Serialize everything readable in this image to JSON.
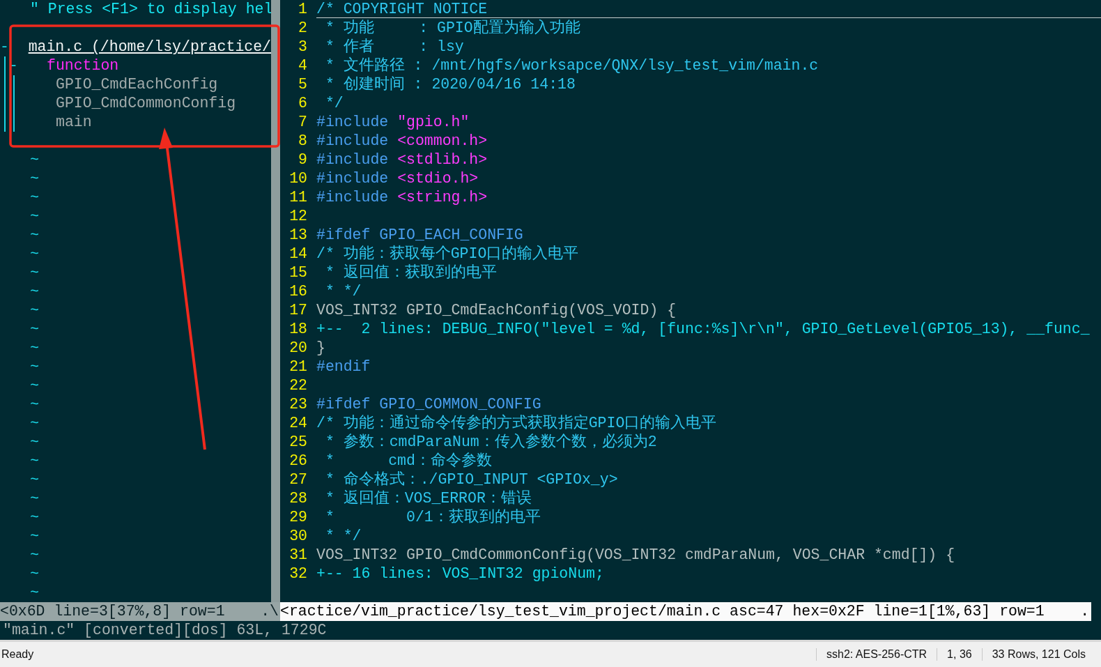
{
  "tag_list": {
    "help": "\" Press <F1> to display hel",
    "tree": {
      "marker": "-",
      "label": "main.c (/home/lsy/practice/",
      "children": [
        {
          "marker": "-",
          "label": "function",
          "children": [
            {
              "label": "GPIO_CmdEachConfig"
            },
            {
              "label": "GPIO_CmdCommonConfig"
            },
            {
              "label": "main"
            }
          ]
        }
      ]
    },
    "filler_rows": [
      "~",
      "~",
      "~",
      "~",
      "~",
      "~",
      "~",
      "~",
      "~",
      "~",
      "~",
      "~",
      "~",
      "~",
      "~",
      "~",
      "~",
      "~",
      "~",
      "~",
      "~",
      "~",
      "~",
      "~"
    ],
    "status_line": "<0x6D line=3[37%,8] row=1    .\\"
  },
  "editor": {
    "lines": [
      {
        "number": "1",
        "cursor_line": true,
        "segments": [
          {
            "kind": "comment",
            "text": "/* COPYRIGHT NOTICE"
          }
        ]
      },
      {
        "number": "2",
        "segments": [
          {
            "kind": "comment",
            "text": " * 功能     : GPIO配置为输入功能"
          }
        ]
      },
      {
        "number": "3",
        "segments": [
          {
            "kind": "comment",
            "text": " * 作者     : lsy"
          }
        ]
      },
      {
        "number": "4",
        "segments": [
          {
            "kind": "comment",
            "text": " * 文件路径 : /mnt/hgfs/worksapce/QNX/lsy_test_vim/main.c"
          }
        ]
      },
      {
        "number": "5",
        "segments": [
          {
            "kind": "comment",
            "text": " * 创建时间 : 2020/04/16 14:18"
          }
        ]
      },
      {
        "number": "6",
        "segments": [
          {
            "kind": "comment",
            "text": " */"
          }
        ]
      },
      {
        "number": "7",
        "segments": [
          {
            "kind": "preproc",
            "text": "#include "
          },
          {
            "kind": "string",
            "text": "\"gpio.h\""
          }
        ]
      },
      {
        "number": "8",
        "segments": [
          {
            "kind": "preproc",
            "text": "#include "
          },
          {
            "kind": "string",
            "text": "<common.h>"
          }
        ]
      },
      {
        "number": "9",
        "segments": [
          {
            "kind": "preproc",
            "text": "#include "
          },
          {
            "kind": "string",
            "text": "<stdlib.h>"
          }
        ]
      },
      {
        "number": "10",
        "segments": [
          {
            "kind": "preproc",
            "text": "#include "
          },
          {
            "kind": "string",
            "text": "<stdio.h>"
          }
        ]
      },
      {
        "number": "11",
        "segments": [
          {
            "kind": "preproc",
            "text": "#include "
          },
          {
            "kind": "string",
            "text": "<string.h>"
          }
        ]
      },
      {
        "number": "12"
      },
      {
        "number": "13",
        "segments": [
          {
            "kind": "preproc",
            "text": "#ifdef GPIO_EACH_CONFIG"
          }
        ]
      },
      {
        "number": "14",
        "segments": [
          {
            "kind": "comment",
            "text": "/* 功能：获取每个GPIO口的输入电平"
          }
        ]
      },
      {
        "number": "15",
        "segments": [
          {
            "kind": "comment",
            "text": " * 返回值：获取到的电平"
          }
        ]
      },
      {
        "number": "16",
        "segments": [
          {
            "kind": "comment",
            "text": " * */"
          }
        ]
      },
      {
        "number": "17",
        "segments": [
          {
            "kind": "plain",
            "text": "VOS_INT32 GPIO_CmdEachConfig(VOS_VOID) {"
          }
        ]
      },
      {
        "number": "18",
        "segments": [
          {
            "kind": "fold",
            "text": "+--  2 lines: DEBUG_INFO(\"level = %d, [func:%s]\\r\\n\", GPIO_GetLevel(GPIO5_13), __func_"
          }
        ]
      },
      {
        "number": "20",
        "segments": [
          {
            "kind": "plain",
            "text": "}"
          }
        ]
      },
      {
        "number": "21",
        "segments": [
          {
            "kind": "preproc",
            "text": "#endif"
          }
        ]
      },
      {
        "number": "22"
      },
      {
        "number": "23",
        "segments": [
          {
            "kind": "preproc",
            "text": "#ifdef GPIO_COMMON_CONFIG"
          }
        ]
      },
      {
        "number": "24",
        "segments": [
          {
            "kind": "comment",
            "text": "/* 功能：通过命令传参的方式获取指定GPIO口的输入电平"
          }
        ]
      },
      {
        "number": "25",
        "segments": [
          {
            "kind": "comment",
            "text": " * 参数：cmdParaNum：传入参数个数，必须为2"
          }
        ]
      },
      {
        "number": "26",
        "segments": [
          {
            "kind": "comment",
            "text": " *      cmd：命令参数"
          }
        ]
      },
      {
        "number": "27",
        "segments": [
          {
            "kind": "comment",
            "text": " * 命令格式：./GPIO_INPUT <GPIOx_y>"
          }
        ]
      },
      {
        "number": "28",
        "segments": [
          {
            "kind": "comment",
            "text": " * 返回值：VOS_ERROR：错误"
          }
        ]
      },
      {
        "number": "29",
        "segments": [
          {
            "kind": "comment",
            "text": " *        0/1：获取到的电平"
          }
        ]
      },
      {
        "number": "30",
        "segments": [
          {
            "kind": "comment",
            "text": " * */"
          }
        ]
      },
      {
        "number": "31",
        "segments": [
          {
            "kind": "plain",
            "text": "VOS_INT32 GPIO_CmdCommonConfig(VOS_INT32 cmdParaNum, VOS_CHAR *cmd[]) {"
          }
        ]
      },
      {
        "number": "32",
        "segments": [
          {
            "kind": "fold",
            "text": "+-- 16 lines: VOS_INT32 gpioNum;"
          }
        ]
      }
    ],
    "status_line": "<ractice/vim_practice/lsy_test_vim_project/main.c asc=47 hex=0x2F line=1[1%,63] row=1    ."
  },
  "message_line": "\"main.c\" [converted][dos] 63L, 1729C",
  "status_bar": {
    "left": "Ready",
    "cipher": "ssh2: AES-256-CTR",
    "cursor": "1, 36",
    "size": "33 Rows, 121 Cols"
  }
}
